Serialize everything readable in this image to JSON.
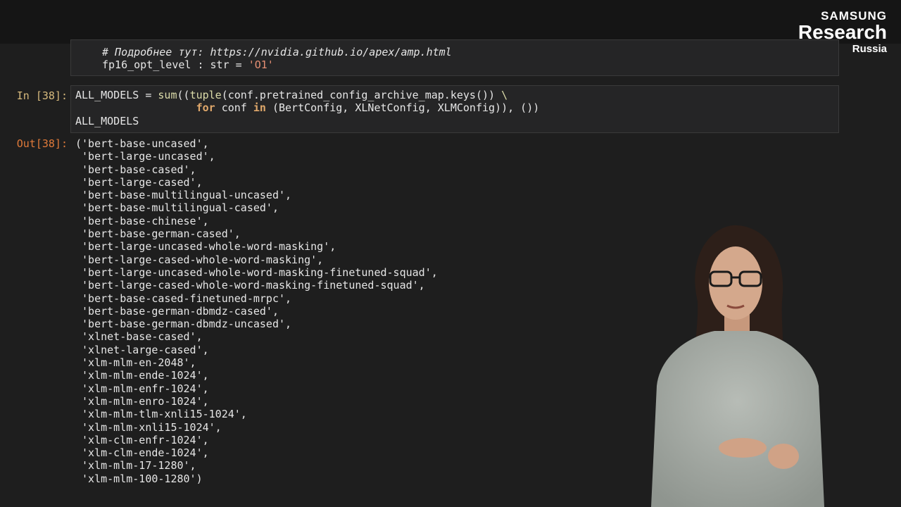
{
  "logo": {
    "brand": "SAMSUNG",
    "name": "Research",
    "region": "Russia"
  },
  "cell1": {
    "comment": "# Подробнее тут: https://nvidia.github.io/apex/amp.html",
    "line2_var": "fp16_opt_level",
    "line2_sep": " : ",
    "line2_type": "str",
    "line2_eq": " = ",
    "line2_value": "'O1'"
  },
  "cell2": {
    "prompt": "In [38]:",
    "line1_var": "ALL_MODELS = ",
    "line1_fn1": "sum",
    "line1_mid": "((",
    "line1_fn2": "tuple",
    "line1_rest": "(conf.pretrained_config_archive_map.keys()) ",
    "line1_cont": "\\",
    "line2_indent": "                   ",
    "line2_kw1": "for",
    "line2_mid": " conf ",
    "line2_kw2": "in",
    "line2_rest": " (BertConfig, XLNetConfig, XLMConfig)), ())",
    "line3": "ALL_MODELS"
  },
  "output": {
    "prompt": "Out[38]:",
    "lines": [
      "('bert-base-uncased',",
      " 'bert-large-uncased',",
      " 'bert-base-cased',",
      " 'bert-large-cased',",
      " 'bert-base-multilingual-uncased',",
      " 'bert-base-multilingual-cased',",
      " 'bert-base-chinese',",
      " 'bert-base-german-cased',",
      " 'bert-large-uncased-whole-word-masking',",
      " 'bert-large-cased-whole-word-masking',",
      " 'bert-large-uncased-whole-word-masking-finetuned-squad',",
      " 'bert-large-cased-whole-word-masking-finetuned-squad',",
      " 'bert-base-cased-finetuned-mrpc',",
      " 'bert-base-german-dbmdz-cased',",
      " 'bert-base-german-dbmdz-uncased',",
      " 'xlnet-base-cased',",
      " 'xlnet-large-cased',",
      " 'xlm-mlm-en-2048',",
      " 'xlm-mlm-ende-1024',",
      " 'xlm-mlm-enfr-1024',",
      " 'xlm-mlm-enro-1024',",
      " 'xlm-mlm-tlm-xnli15-1024',",
      " 'xlm-mlm-xnli15-1024',",
      " 'xlm-clm-enfr-1024',",
      " 'xlm-clm-ende-1024',",
      " 'xlm-mlm-17-1280',",
      " 'xlm-mlm-100-1280')"
    ]
  }
}
